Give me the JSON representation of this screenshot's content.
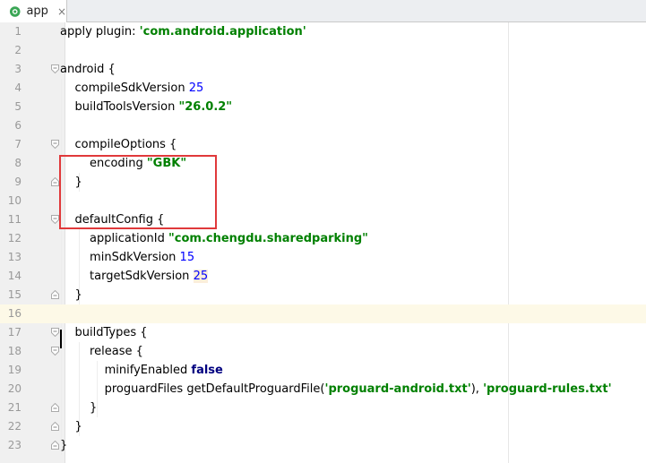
{
  "tab": {
    "label": "app",
    "close_glyph": "×",
    "icon": "gradle-module-icon"
  },
  "lines": [
    {
      "n": "1"
    },
    {
      "n": "2"
    },
    {
      "n": "3"
    },
    {
      "n": "4"
    },
    {
      "n": "5"
    },
    {
      "n": "6"
    },
    {
      "n": "7"
    },
    {
      "n": "8"
    },
    {
      "n": "9"
    },
    {
      "n": "10"
    },
    {
      "n": "11"
    },
    {
      "n": "12"
    },
    {
      "n": "13"
    },
    {
      "n": "14"
    },
    {
      "n": "15"
    },
    {
      "n": "16"
    },
    {
      "n": "17"
    },
    {
      "n": "18"
    },
    {
      "n": "19"
    },
    {
      "n": "20"
    },
    {
      "n": "21"
    },
    {
      "n": "22"
    },
    {
      "n": "23"
    }
  ],
  "code": {
    "l1_a": "apply plugin: ",
    "l1_s": "'com.android.application'",
    "l3": "android {",
    "l4_a": "    compileSdkVersion ",
    "l4_n": "25",
    "l5_a": "    buildToolsVersion ",
    "l5_s": "\"26.0.2\"",
    "l7": "    compileOptions {",
    "l8_a": "        encoding ",
    "l8_s": "\"GBK\"",
    "l9": "    }",
    "l11": "    defaultConfig {",
    "l12_a": "        applicationId ",
    "l12_s": "\"com.chengdu.sharedparking\"",
    "l13_a": "        minSdkVersion ",
    "l13_n": "15",
    "l14_a": "        targetSdkVersion ",
    "l14_n": "25",
    "l15": "    }",
    "l17": "    buildTypes {",
    "l18": "        release {",
    "l19_a": "            minifyEnabled ",
    "l19_k": "false",
    "l20_a": "            proguardFiles getDefaultProguardFile(",
    "l20_s1": "'proguard-android.txt'",
    "l20_b": "), ",
    "l20_s2": "'proguard-rules.txt'",
    "l21": "        }",
    "l22": "    }",
    "l23": "}"
  },
  "colors": {
    "string": "#008000",
    "number": "#0000ff",
    "keyword": "#000080",
    "highlight_box": "#e0393b",
    "current_line": "#fdf9e7"
  }
}
